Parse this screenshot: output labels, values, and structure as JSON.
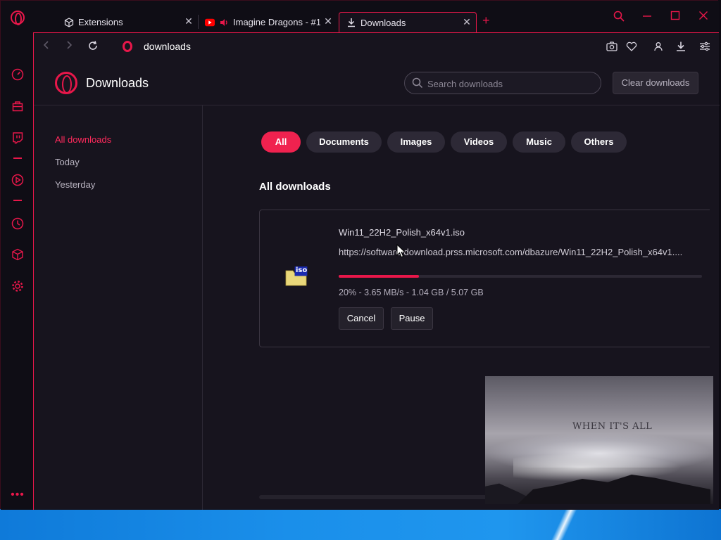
{
  "tabs": [
    {
      "label": "Extensions",
      "icon": "cube-icon"
    },
    {
      "label": "Imagine Dragons - #1 (",
      "icon": "youtube-icon"
    },
    {
      "label": "Downloads",
      "icon": "download-icon"
    }
  ],
  "address": {
    "text": "downloads"
  },
  "header": {
    "title": "Downloads",
    "search_placeholder": "Search downloads",
    "clear_label": "Clear downloads"
  },
  "sidebar": {
    "items": [
      {
        "label": "All downloads",
        "active": true
      },
      {
        "label": "Today",
        "active": false
      },
      {
        "label": "Yesterday",
        "active": false
      }
    ]
  },
  "filters": [
    {
      "label": "All",
      "active": true
    },
    {
      "label": "Documents",
      "active": false
    },
    {
      "label": "Images",
      "active": false
    },
    {
      "label": "Videos",
      "active": false
    },
    {
      "label": "Music",
      "active": false
    },
    {
      "label": "Others",
      "active": false
    }
  ],
  "section_title": "All downloads",
  "download": {
    "filename": "Win11_22H2_Polish_x64v1.iso",
    "url": "https://software-download.prss.microsoft.com/dbazure/Win11_22H2_Polish_x64v1....",
    "file_icon_label": "iso",
    "progress": 0.2,
    "status": "20% - 3.65 MB/s - 1.04 GB / 5.07 GB",
    "cancel_label": "Cancel",
    "pause_label": "Pause"
  },
  "video_popout": {
    "caption": "WHEN IT'S ALL"
  },
  "colors": {
    "accent": "#e8174a",
    "background": "#17141e",
    "desktop": "#1a8fea"
  }
}
